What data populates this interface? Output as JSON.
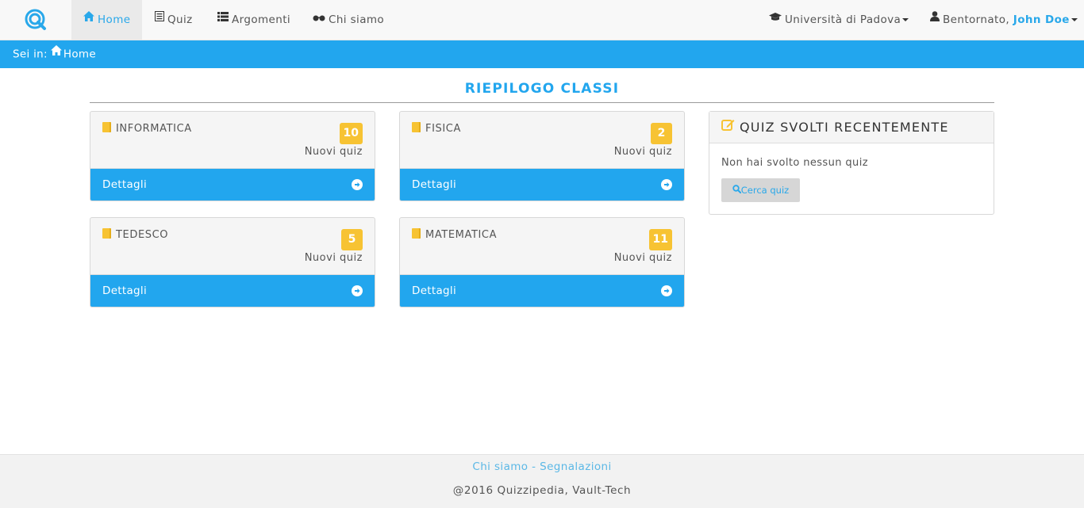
{
  "nav": {
    "logo": "quizzipedia-logo",
    "items": [
      {
        "label": "Home",
        "icon": "home-icon",
        "active": true
      },
      {
        "label": "Quiz",
        "icon": "list-icon"
      },
      {
        "label": "Argomenti",
        "icon": "th-list-icon"
      },
      {
        "label": "Chi siamo",
        "icon": "glasses-icon"
      }
    ],
    "university": "Università di Padova",
    "greeting": "Bentornato, ",
    "username": "John Doe"
  },
  "breadcrumb": {
    "prefix": "Sei in:",
    "current": "Home"
  },
  "main": {
    "title": "RIEPILOGO CLASSI",
    "classes": [
      {
        "name": "INFORMATICA",
        "count": "10",
        "count_label": "Nuovi quiz",
        "action": "Dettagli"
      },
      {
        "name": "FISICA",
        "count": "2",
        "count_label": "Nuovi quiz",
        "action": "Dettagli"
      },
      {
        "name": "TEDESCO",
        "count": "5",
        "count_label": "Nuovi quiz",
        "action": "Dettagli"
      },
      {
        "name": "MATEMATICA",
        "count": "11",
        "count_label": "Nuovi quiz",
        "action": "Dettagli"
      }
    ]
  },
  "recent": {
    "title": "QUIZ SVOLTI RECENTEMENTE",
    "empty_text": "Non hai svolto nessun quiz",
    "search_label": "Cerca quiz"
  },
  "footer": {
    "link_about": "Chi siamo",
    "separator": " - ",
    "link_report": "Segnalazioni",
    "copyright": "@2016 Quizzipedia, Vault-Tech"
  },
  "colors": {
    "accent": "#22a6ee",
    "badge": "#f7c333",
    "navbar": "#f8f8f8"
  }
}
